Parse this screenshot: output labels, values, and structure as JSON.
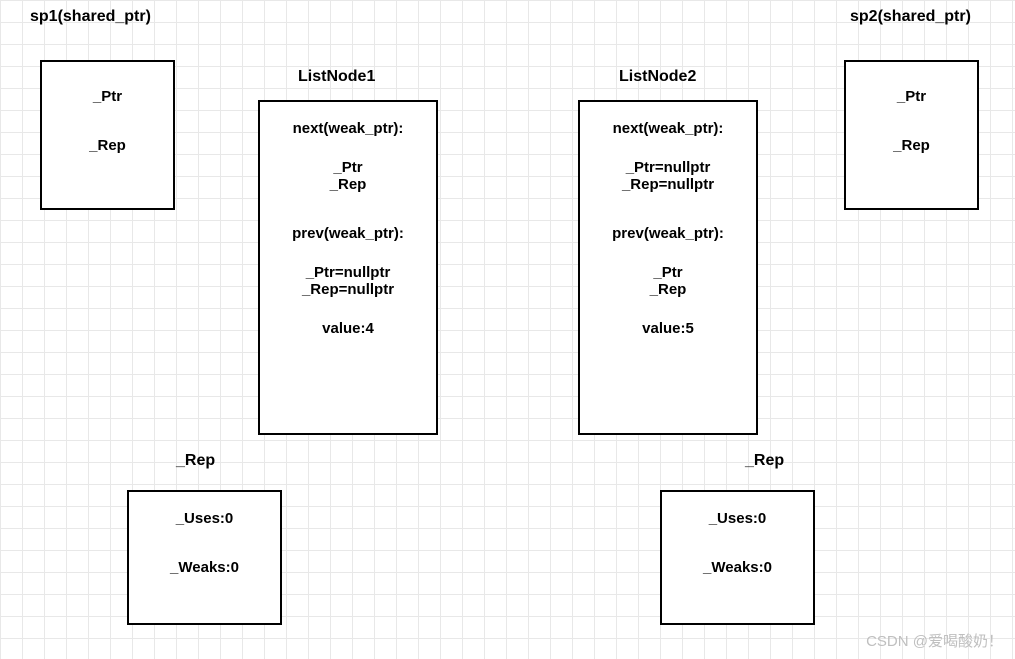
{
  "sp1": {
    "title": "sp1(shared_ptr)",
    "ptr": "_Ptr",
    "rep": "_Rep"
  },
  "sp2": {
    "title": "sp2(shared_ptr)",
    "ptr": "_Ptr",
    "rep": "_Rep"
  },
  "node1": {
    "title": "ListNode1",
    "next_label": "next(weak_ptr):",
    "next_ptr": "_Ptr",
    "next_rep": "_Rep",
    "prev_label": "prev(weak_ptr):",
    "prev_ptr": "_Ptr=nullptr",
    "prev_rep": "_Rep=nullptr",
    "value": "value:4"
  },
  "node2": {
    "title": "ListNode2",
    "next_label": "next(weak_ptr):",
    "next_ptr": "_Ptr=nullptr",
    "next_rep": "_Rep=nullptr",
    "prev_label": "prev(weak_ptr):",
    "prev_ptr": "_Ptr",
    "prev_rep": "_Rep",
    "value": "value:5"
  },
  "rep1": {
    "title": "_Rep",
    "uses": "_Uses:0",
    "weaks": "_Weaks:0"
  },
  "rep2": {
    "title": "_Rep",
    "uses": "_Uses:0",
    "weaks": "_Weaks:0"
  },
  "watermark": "CSDN @爱喝酸奶！"
}
